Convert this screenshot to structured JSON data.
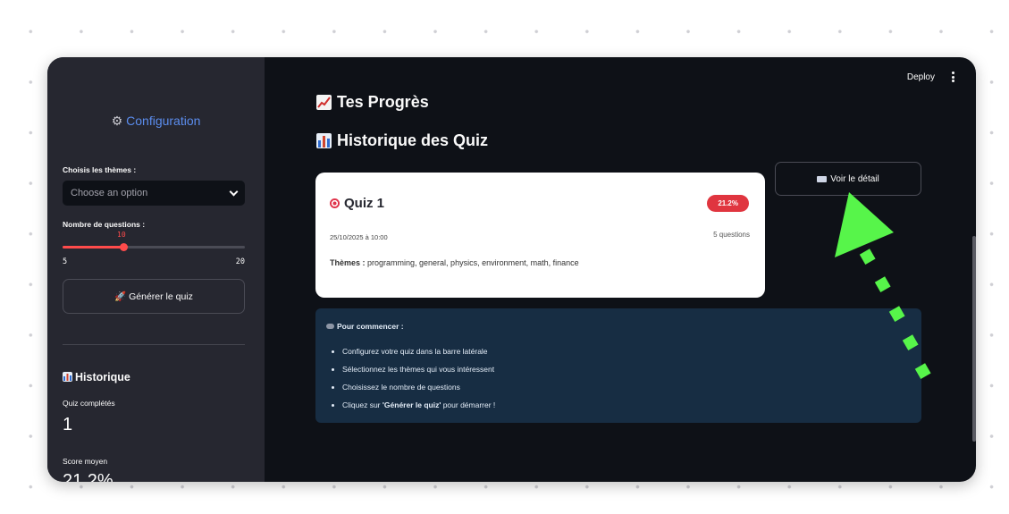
{
  "sidebar": {
    "config_title": "Configuration",
    "themes_label": "Choisis les thèmes :",
    "themes_placeholder": "Choose an option",
    "questions_label": "Nombre de questions :",
    "slider": {
      "value": "10",
      "min": "5",
      "max": "20",
      "current": 10,
      "range_min": 5,
      "range_max": 20
    },
    "generate_button": "🚀 Générer le quiz",
    "history_title": "Historique",
    "completed_label": "Quiz complétés",
    "completed_value": "1",
    "avg_label": "Score moyen",
    "avg_value": "21.2%"
  },
  "header": {
    "deploy": "Deploy"
  },
  "main": {
    "progress_title": "Tes Progrès",
    "history_title": "Historique des Quiz",
    "quiz_card": {
      "title": "Quiz 1",
      "score": "21.2%",
      "date": "25/10/2025 à 10:00",
      "questions": "5 questions",
      "themes_label": "Thèmes :",
      "themes": " programming, general, physics, environment, math, finance"
    },
    "detail_button": "Voir le détail",
    "info_title": "Pour commencer :",
    "steps": [
      "Configurez votre quiz dans la barre latérale",
      "Sélectionnez les thèmes qui vous intéressent",
      "Choisissez le nombre de questions"
    ],
    "last_step": {
      "prefix": "Cliquez sur ",
      "bold": "'Générer le quiz'",
      "suffix": " pour démarrer !"
    }
  },
  "colors": {
    "accent": "#ff4b4b",
    "arrow": "#57f54a",
    "info_bg": "#172d43",
    "sidebar_bg": "#262730",
    "main_bg": "#0e1117"
  },
  "icons": [
    "gear-icon",
    "chevron-down-icon",
    "rocket-icon",
    "chart-up-icon",
    "bar-chart-icon",
    "target-icon",
    "book-icon",
    "gamepad-icon",
    "kebab-menu-icon",
    "arrow-pointer"
  ]
}
